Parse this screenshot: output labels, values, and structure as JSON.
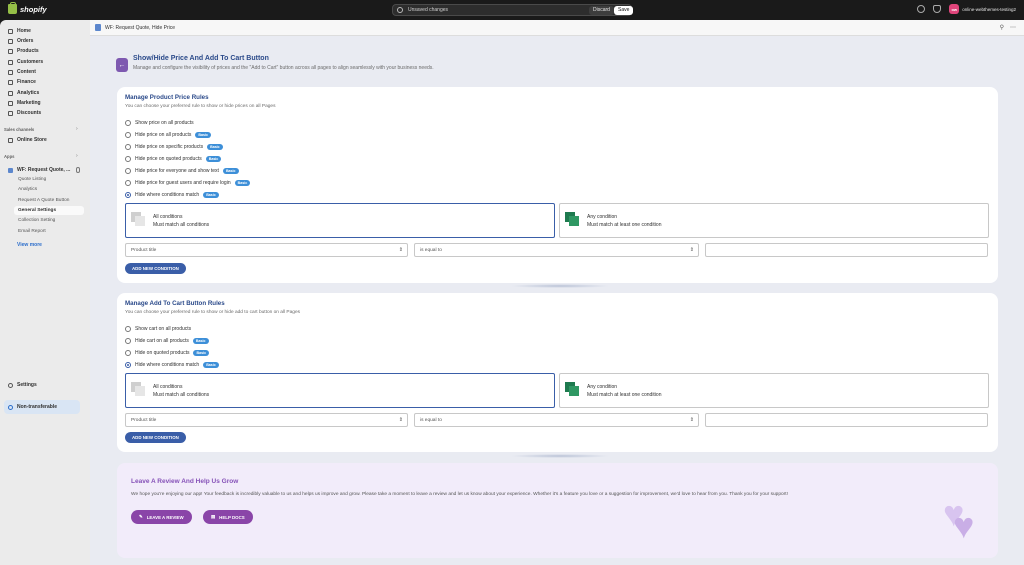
{
  "topbar": {
    "logo_text": "shopify",
    "unsaved_text": "Unsaved changes",
    "discard_label": "Discard",
    "save_label": "Save",
    "avatar_initials": "ow",
    "store_name": "online-webthemes-testing2"
  },
  "sidebar": {
    "nav": [
      {
        "label": "Home",
        "icon": "home-icon"
      },
      {
        "label": "Orders",
        "icon": "orders-icon"
      },
      {
        "label": "Products",
        "icon": "tag-icon"
      },
      {
        "label": "Customers",
        "icon": "person-icon"
      },
      {
        "label": "Content",
        "icon": "content-icon"
      },
      {
        "label": "Finance",
        "icon": "bank-icon"
      },
      {
        "label": "Analytics",
        "icon": "chart-icon"
      },
      {
        "label": "Marketing",
        "icon": "target-icon"
      },
      {
        "label": "Discounts",
        "icon": "discount-icon"
      }
    ],
    "sales_channels_label": "Sales channels",
    "online_store": "Online Store",
    "apps_label": "Apps",
    "app_name": "WF: Request Quote, ...",
    "app_subitems": [
      "Quote Listing",
      "Analytics",
      "Request A Quote Button",
      "General Settings",
      "Collection Setting",
      "Email Report"
    ],
    "active_subitem": "General Settings",
    "view_more": "View more",
    "settings": "Settings",
    "non_transferable": "Non-transferable"
  },
  "app_header": {
    "title": "WF: Request Quote, Hide Price"
  },
  "page": {
    "title": "Show/Hide Price And Add To Cart Button",
    "subtitle": "Manage and configure the visibility of prices and the \"Add to Cart\" button across all pages to align seamlessly with your business needs."
  },
  "price_rules": {
    "title": "Manage Product Price Rules",
    "subtitle": "You can choose your preferred rule to show or hide prices on all Pages",
    "options": [
      {
        "label": "Show price on all products",
        "badge": ""
      },
      {
        "label": "Hide price on all products",
        "badge": "Basic"
      },
      {
        "label": "Hide price on specific products",
        "badge": "Basic"
      },
      {
        "label": "Hide price on quoted products",
        "badge": "Basic"
      },
      {
        "label": "Hide price for everyone and show text",
        "badge": "Basic"
      },
      {
        "label": "Hide price for guest users and require login",
        "badge": "Basic"
      },
      {
        "label": "Hide where conditions match",
        "badge": "Basic"
      }
    ],
    "selected_index": 6,
    "all_conditions_title": "All conditions",
    "all_conditions_sub": "Must match all conditions",
    "any_condition_title": "Any condition",
    "any_condition_sub": "Must match at least one condition",
    "field_select": "Product title",
    "operator_select": "is equal to",
    "value_input": "",
    "add_condition_label": "ADD NEW CONDITION"
  },
  "cart_rules": {
    "title": "Manage Add To Cart Button Rules",
    "subtitle": "You can choose your preferred rule to show or hide add to cart button on all Pages",
    "options": [
      {
        "label": "Show cart on all products",
        "badge": ""
      },
      {
        "label": "Hide cart on all products",
        "badge": "Basic"
      },
      {
        "label": "Hide on quoted products",
        "badge": "Basic"
      },
      {
        "label": "Hide where conditions match",
        "badge": "Basic"
      }
    ],
    "selected_index": 3,
    "all_conditions_title": "All conditions",
    "all_conditions_sub": "Must match all conditions",
    "any_condition_title": "Any condition",
    "any_condition_sub": "Must match at least one condition",
    "field_select": "Product title",
    "operator_select": "is equal to",
    "value_input": "",
    "add_condition_label": "ADD NEW CONDITION"
  },
  "review": {
    "title": "Leave A Review And Help Us Grow",
    "text": "We hope you're enjoying our app! Your feedback is incredibly valuable to us and helps us improve and grow. Please take a moment to leave a review and let us know about your experience. Whether it's a feature you love or a suggestion for improvement, we'd love to hear from you. Thank you for your support!",
    "leave_review_label": "LEAVE A REVIEW",
    "help_docs_label": "HELP DOCS"
  },
  "colors": {
    "accent_blue": "#3a5ea8",
    "title_blue": "#2b4a8a",
    "badge_blue": "#3d8fd8",
    "purple": "#8a45a8"
  }
}
